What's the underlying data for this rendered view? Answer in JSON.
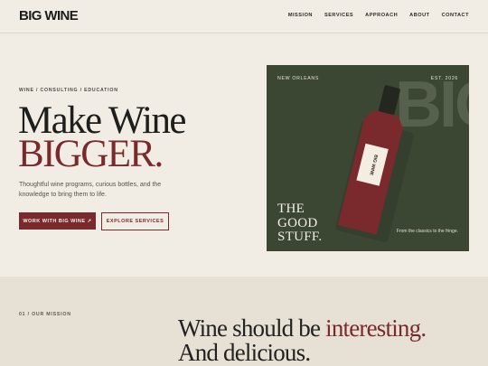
{
  "brand": {
    "logo": "BIG WINE"
  },
  "nav": {
    "items": [
      "MISSION",
      "SERVICES",
      "APPROACH",
      "ABOUT",
      "CONTACT"
    ]
  },
  "hero": {
    "eyebrow": "WINE / CONSULTING / EDUCATION",
    "title_line1": "Make Wine",
    "title_line2": "BIGGER.",
    "lede": "Thoughtful wine programs, curious bottles, and the knowledge to bring them to life.",
    "primary_button": "WORK WITH BIG WINE ↗",
    "secondary_button": "EXPLORE SERVICES"
  },
  "card": {
    "location": "NEW ORLEANS",
    "established": "EST. 2026",
    "background_text": "BIG",
    "bottle_label": "BIG WINE",
    "tagline_1": "THE",
    "tagline_2": "GOOD",
    "tagline_3": "STUFF.",
    "caption": "From the classics to the fringe."
  },
  "mission": {
    "label": "01 / OUR MISSION",
    "headline_part1": "Wine should be ",
    "headline_accent": "interesting.",
    "headline_line2": "And delicious."
  },
  "colors": {
    "background": "#f1ede4",
    "accent_wine": "#7a2a2c",
    "card_green": "#3b4633",
    "mission_bg": "#e7e0d4"
  }
}
